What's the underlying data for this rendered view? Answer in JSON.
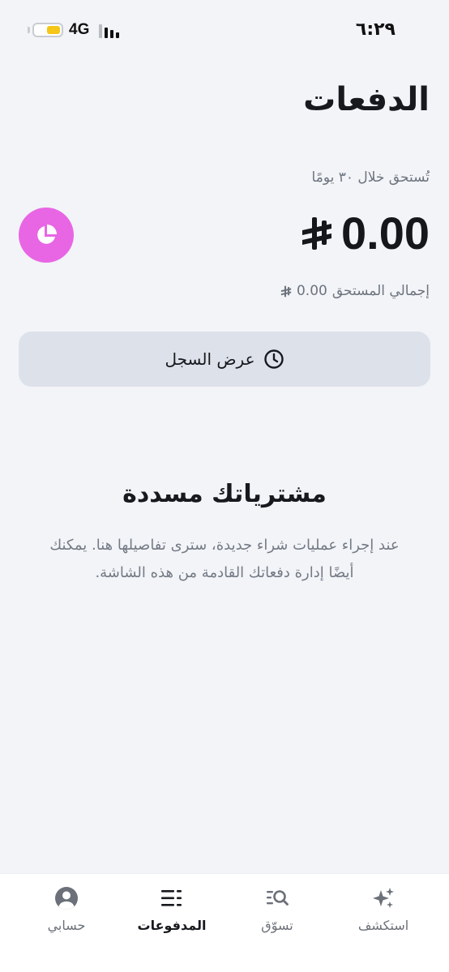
{
  "status_bar": {
    "time": "٦:٢٩",
    "network": "4G"
  },
  "header": {
    "title": "الدفعات"
  },
  "summary": {
    "due_label": "تُستحق خلال ٣٠ يومًا",
    "amount": "0.00",
    "total_due_label": "إجمالي المستحق",
    "total_due_amount": "0.00",
    "badge_color": "#e866e4"
  },
  "history_button": {
    "label": "عرض السجل"
  },
  "empty_state": {
    "title": "مشترياتك مسددة",
    "line1": "عند إجراء عمليات شراء جديدة، سترى تفاصيلها هنا. يمكنك",
    "line2": "أيضًا إدارة دفعاتك القادمة من هذه الشاشة."
  },
  "bottom_nav": {
    "items": [
      {
        "label": "استكشف",
        "icon": "sparkles-icon",
        "active": false
      },
      {
        "label": "تسوّق",
        "icon": "search-list-icon",
        "active": false
      },
      {
        "label": "المدفوعات",
        "icon": "list-icon",
        "active": true
      },
      {
        "label": "حسابي",
        "icon": "user-icon",
        "active": false
      }
    ]
  }
}
